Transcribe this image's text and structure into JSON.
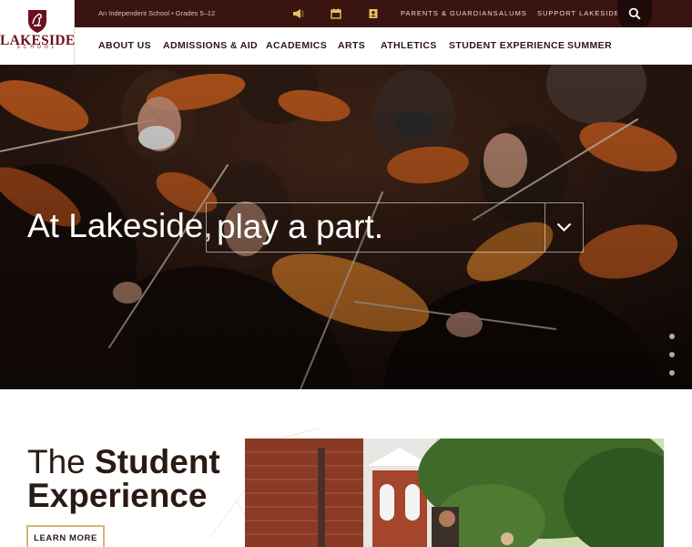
{
  "header": {
    "logo": {
      "name": "LAKESIDE",
      "sub": "SCHOOL"
    },
    "tagline": "An Independent School • Grades 5–12",
    "utility_icons": [
      "megaphone-icon",
      "calendar-icon",
      "directory-icon"
    ],
    "utility_links": [
      "PARENTS & GUARDIANS",
      "ALUMS",
      "SUPPORT LAKESIDE"
    ],
    "search_icon": "search-icon"
  },
  "nav": {
    "items": [
      "ABOUT US",
      "ADMISSIONS & AID",
      "ACADEMICS",
      "ARTS",
      "ATHLETICS",
      "STUDENT EXPERIENCE",
      "SUMMER"
    ]
  },
  "hero": {
    "lead": "At Lakeside,",
    "selected_option": "play a part.",
    "dropdown_icon": "chevron-down-icon",
    "slide_count": 3
  },
  "feature": {
    "title_light": "The ",
    "title_bold_1": "Student",
    "title_bold_2": "Experience",
    "button": "LEARN MORE"
  },
  "colors": {
    "brand_maroon": "#6b1020",
    "utility_bg": "#3a1410",
    "accent_gold": "#d8b67a",
    "text_dark": "#2a1a14"
  }
}
